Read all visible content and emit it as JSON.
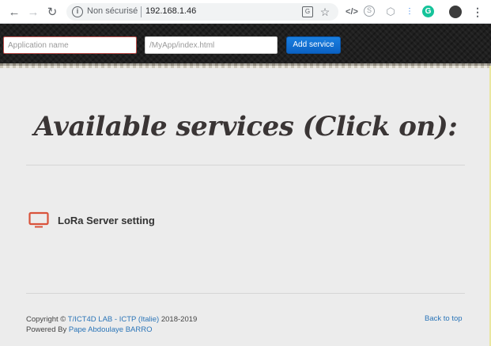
{
  "browser": {
    "back_icon": "arrow-left",
    "forward_icon": "arrow-right",
    "reload_icon": "reload",
    "security_text": "Non sécurisé",
    "url": "192.168.1.46",
    "toolbar_icons": [
      "translate-icon",
      "bookmark-star-icon"
    ],
    "extension_icons": [
      "code-icon",
      "skype-icon",
      "shield-icon",
      "dots-icon",
      "grammarly-icon",
      "profile-icon",
      "menu-icon"
    ]
  },
  "toolbar": {
    "app_placeholder": "Application name",
    "path_placeholder": "/MyApp/index.html",
    "add_label": "Add service"
  },
  "main": {
    "heading": "Available services (Click on):",
    "services": [
      {
        "label": "LoRa Server setting",
        "icon": "monitor-icon"
      }
    ]
  },
  "footer": {
    "copyright_prefix": "Copyright ©",
    "copyright_link": "T/ICT4D LAB - ICTP (Italie)",
    "copyright_years": "2018-2019",
    "powered_prefix": "Powered By",
    "powered_link": "Pape Abdoulaye BARRO",
    "back_to_top": "Back to top"
  },
  "colors": {
    "accent": "#0b62c4",
    "link": "#2b75b8",
    "icon": "#d9533b",
    "input_error_border": "#c0504d"
  }
}
